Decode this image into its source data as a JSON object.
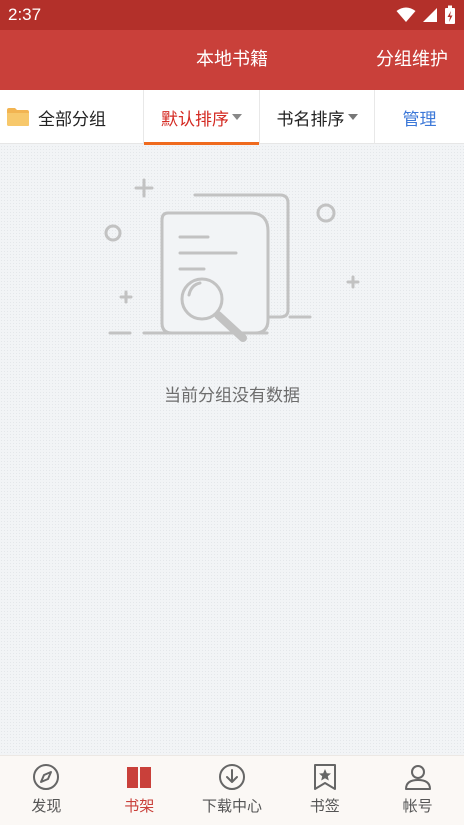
{
  "status_bar": {
    "time": "2:37"
  },
  "header": {
    "title": "本地书籍",
    "action_label": "分组维护"
  },
  "toolbar": {
    "group_label": "全部分组",
    "sort_default_label": "默认排序",
    "sort_name_label": "书名排序",
    "manage_label": "管理"
  },
  "empty_state": {
    "message": "当前分组没有数据"
  },
  "bottom_nav": {
    "items": [
      {
        "label": "发现",
        "icon": "compass-icon"
      },
      {
        "label": "书架",
        "icon": "book-icon"
      },
      {
        "label": "下载中心",
        "icon": "download-icon"
      },
      {
        "label": "书签",
        "icon": "bookmark-icon"
      },
      {
        "label": "帐号",
        "icon": "user-icon"
      }
    ],
    "active_index": 1
  },
  "colors": {
    "status_bar": "#b3302a",
    "title_bar": "#c9403a",
    "active_tab": "#d42a22",
    "tab_underline": "#ef6a1e",
    "manage_link": "#3c78d8"
  }
}
